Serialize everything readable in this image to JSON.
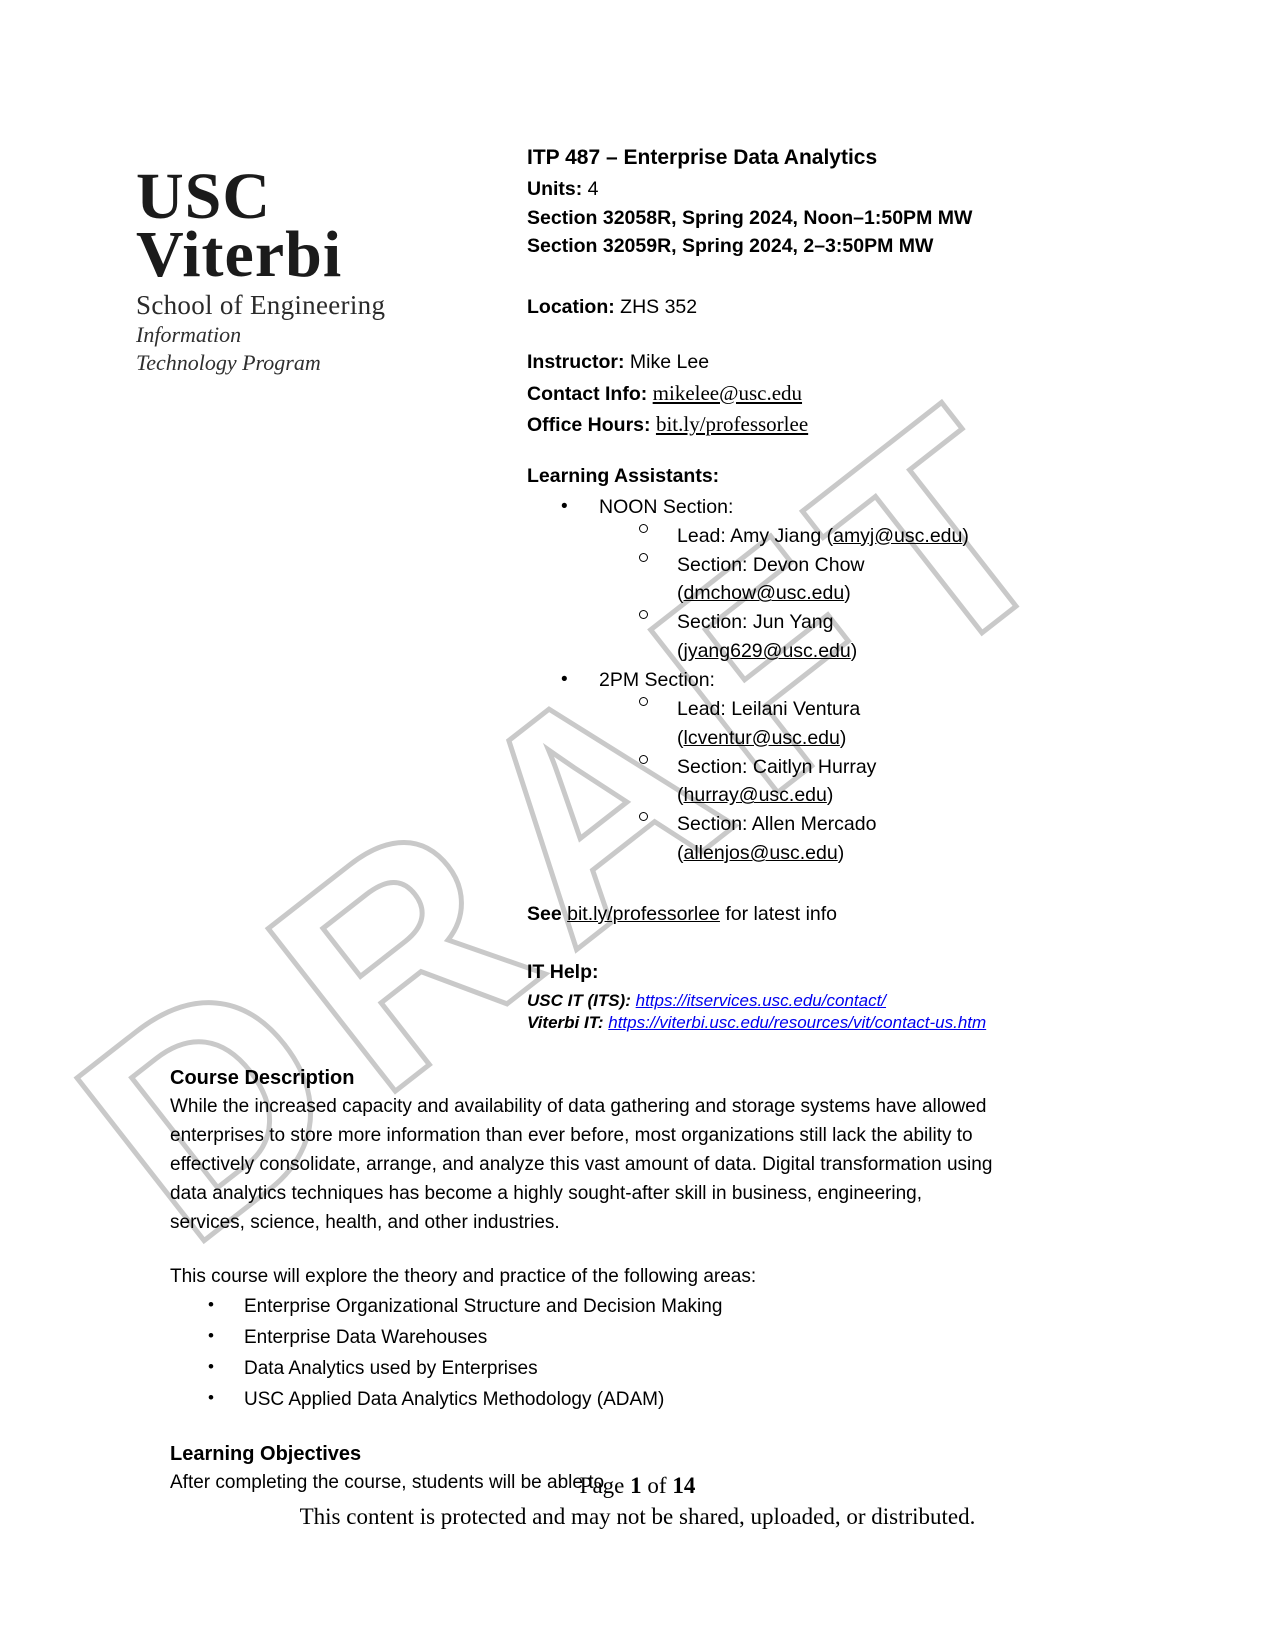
{
  "logo": {
    "usc": "USC",
    "viterbi": "Viterbi",
    "school": "School of Engineering",
    "program_line1": "Information",
    "program_line2": "Technology Program"
  },
  "watermark": {
    "text": "DRAFT"
  },
  "header": {
    "course_title": "ITP 487 – Enterprise Data Analytics",
    "units_label": "Units:",
    "units_value": "4",
    "section1": "Section 32058R, Spring 2024, Noon–1:50PM MW",
    "section2": "Section 32059R, Spring 2024, 2–3:50PM MW"
  },
  "meta": {
    "location_label": "Location:",
    "location_value": "ZHS 352",
    "instructor_label": "Instructor:",
    "instructor_value": "Mike Lee",
    "contact_label": "Contact Info:",
    "contact_value": "mikelee@usc.edu",
    "office_hours_label": "Office Hours:",
    "office_hours_value": "bit.ly/professorlee"
  },
  "learning_assistants": {
    "heading": "Learning Assistants:",
    "groups": [
      {
        "label": "NOON Section:",
        "members": [
          {
            "role_name": "Lead: Amy Jiang",
            "email": "amyj@usc.edu",
            "inline": true
          },
          {
            "role_name": "Section: Devon Chow",
            "email": "dmchow@usc.edu",
            "inline": false
          },
          {
            "role_name": "Section: Jun Yang",
            "email": "jyang629@usc.edu",
            "inline": false
          }
        ]
      },
      {
        "label": "2PM Section:",
        "members": [
          {
            "role_name": "Lead: Leilani Ventura",
            "email": "lcventur@usc.edu",
            "inline": false
          },
          {
            "role_name": "Section: Caitlyn Hurray",
            "email": "hurray@usc.edu",
            "inline": false
          },
          {
            "role_name": "Section: Allen Mercado",
            "email": "allenjos@usc.edu",
            "inline": false
          }
        ]
      }
    ]
  },
  "see_line": {
    "prefix": "See",
    "link": "bit.ly/professorlee",
    "suffix": "for latest info"
  },
  "it_help": {
    "heading": "IT Help:",
    "rows": [
      {
        "label": "USC IT (ITS):",
        "url": "https://itservices.usc.edu/contact/"
      },
      {
        "label": "Viterbi IT:",
        "url": "https://viterbi.usc.edu/resources/vit/contact-us.htm"
      }
    ]
  },
  "course_description": {
    "heading": "Course Description",
    "paragraph": "While the increased capacity and availability of data gathering and storage systems have allowed enterprises to store more information than ever before, most organizations still lack the ability to effectively consolidate, arrange, and analyze this vast amount of data. Digital transformation using data analytics techniques has become a highly sought-after skill in business, engineering, services, science, health, and other industries.",
    "intro": "This course will explore the theory and practice of the following areas:",
    "topics": [
      "Enterprise Organizational Structure and Decision Making",
      "Enterprise Data Warehouses",
      "Data Analytics used by Enterprises",
      "USC Applied Data Analytics Methodology (ADAM)"
    ]
  },
  "learning_objectives": {
    "heading": "Learning Objectives",
    "intro": "After completing the course, students will be able to"
  },
  "footer": {
    "page_prefix": "Page",
    "page_number": "1",
    "page_of": "of",
    "page_total": "14",
    "notice": "This content is protected and may not be shared, uploaded, or distributed."
  }
}
